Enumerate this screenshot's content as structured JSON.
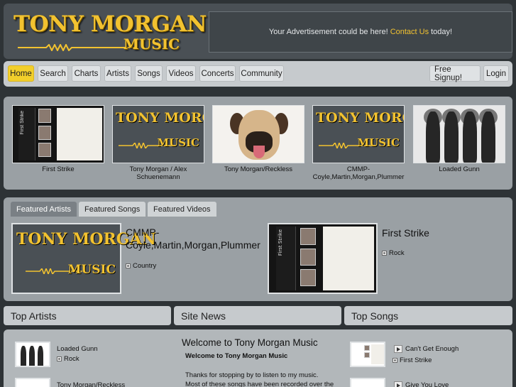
{
  "header": {
    "logo_title": "TONY MORGAN",
    "logo_sub": "MUSIC",
    "ad_text_before": "Your Advertisement could be here!",
    "ad_link": "Contact Us",
    "ad_text_after": "today!"
  },
  "nav": {
    "items": [
      "Home",
      "Search",
      "Charts",
      "Artists",
      "Songs",
      "Videos",
      "Concerts",
      "Community"
    ],
    "signup": "Free Signup!",
    "login": "Login"
  },
  "carousel": {
    "items": [
      {
        "caption": "First Strike"
      },
      {
        "caption": "Tony Morgan / Alex Schuenemann"
      },
      {
        "caption": "Tony Morgan/Reckless"
      },
      {
        "caption": "CMMP-Coyle,Martin,Morgan,Plummer"
      },
      {
        "caption": "Loaded Gunn"
      }
    ],
    "cassette_spine": "First Strike"
  },
  "tabs": {
    "items": [
      "Featured Artists",
      "Featured Songs",
      "Featured Videos"
    ],
    "featured": [
      {
        "name": "CMMP-Coyle,Martin,Morgan,Plummer",
        "genre": "Country"
      },
      {
        "name": "First Strike",
        "genre": "Rock"
      }
    ]
  },
  "sections": {
    "top_artists": "Top Artists",
    "site_news": "Site News",
    "top_songs": "Top Songs"
  },
  "top_artists": [
    {
      "name": "Loaded Gunn",
      "genre": "Rock"
    },
    {
      "name": "Tony Morgan/Reckless",
      "genre": ""
    }
  ],
  "news": {
    "title": "Welcome to Tony Morgan Music",
    "subtitle": "Welcome to Tony Morgan Music",
    "body": "Thanks for stopping by to listen to my music. Most of these songs have been recorded over the last"
  },
  "top_songs": [
    {
      "title": "Can't Get Enough",
      "artist": "First Strike"
    },
    {
      "title": "Give You Love",
      "artist": ""
    }
  ]
}
